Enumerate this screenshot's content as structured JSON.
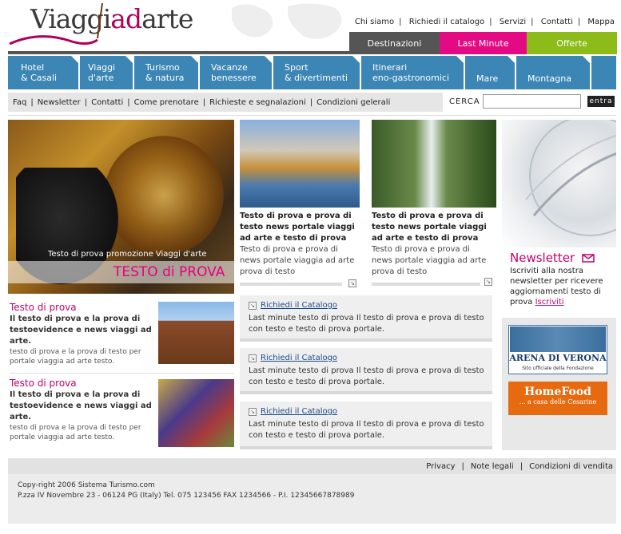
{
  "logo": {
    "part1": "Viaggi",
    "part2": "ad",
    "part3": "arte"
  },
  "topnav": [
    "Chi siamo",
    "Richiedi il catalogo",
    "Servizi",
    "Contatti",
    "Mappa"
  ],
  "tabs": [
    "Destinazioni",
    "Last Minute",
    "Offerte"
  ],
  "categories": [
    {
      "l1": "Hotel",
      "l2": "& Casali"
    },
    {
      "l1": "Viaggi",
      "l2": "d'arte"
    },
    {
      "l1": "Turismo",
      "l2": "& natura"
    },
    {
      "l1": "Vacanze",
      "l2": "benessere"
    },
    {
      "l1": "Sport",
      "l2": "& divertimenti"
    },
    {
      "l1": "Itinerari",
      "l2": "eno-gastronomici"
    },
    {
      "l1": "Mare",
      "l2": ""
    },
    {
      "l1": "Montagna",
      "l2": ""
    }
  ],
  "subnav": [
    "Faq",
    "Newsletter",
    "Contatti",
    "Come prenotare",
    "Richieste e segnalazioni",
    "Condizioni gelerali"
  ],
  "search": {
    "label": "CERCA",
    "button": "entra",
    "value": ""
  },
  "hero": {
    "subtitle": "Testo di prova promozione Viaggi d'arte",
    "title": "TESTO di PROVA"
  },
  "news": [
    {
      "title": "Testo di prova e prova di testo news portale viaggi ad arte e testo di prova",
      "body": "Testo di prova e prova di news portale viaggia ad arte prova di testo"
    },
    {
      "title": "Testo di prova e prova di testo news portale viaggi ad arte e testo di prova",
      "body": "Testo di prova e prova di news portale viaggia ad arte prova di testo"
    }
  ],
  "newsletter": {
    "title": "Newsletter",
    "body": "Iscriviti alla nostra newsletter per ricevere aggiornamenti testo di prova",
    "link": "Iscriviti"
  },
  "left_items": [
    {
      "title": "Testo di prova",
      "bold": "Il testo di prova e la prova di testoevidence e news viaggi ad arte.",
      "small": "testo di prova e la prova di testo per portale viaggia ad arte testo."
    },
    {
      "title": "Testo di prova",
      "bold": "Il testo di prova e la prova di testoevidence e news viaggi ad arte.",
      "small": "testo di prova e la prova di testo per portale viaggia ad arte testo."
    }
  ],
  "catalog_boxes": [
    {
      "link": "Richiedi il Catalogo",
      "text": "Last minute testo di prova Il testo di prova e prova di testo con testo e testo di prova portale."
    },
    {
      "link": "Richiedi il Catalogo",
      "text": "Last minute testo di prova Il testo di prova e prova di testo con testo e testo di prova portale."
    },
    {
      "link": "Richiedi il Catalogo",
      "text": "Last minute testo di prova Il testo di prova e prova di testo con testo e testo di prova portale."
    }
  ],
  "banners": {
    "arena_name": "ARENA DI VERONA",
    "arena_sub": "Sito ufficiale della Fondazione",
    "homefood_name": "HomeFood",
    "homefood_sub": "... a casa delle Cesarine"
  },
  "footer": {
    "links": [
      "Privacy",
      "Note legali",
      "Condizioni di vendita"
    ],
    "copyright": "Copy-right 2006 Sistema Turismo.com",
    "address": "P.zza IV Novembre 23 - 06124 PG (Italy) Tel. 075 123456 FAX 1234566 - P.I. 12345667878989"
  },
  "colors": {
    "accent": "#e40a83",
    "nav_blue": "#3c86b5",
    "green": "#8dbb1a",
    "gray": "#555555",
    "magenta_text": "#c4006a"
  }
}
